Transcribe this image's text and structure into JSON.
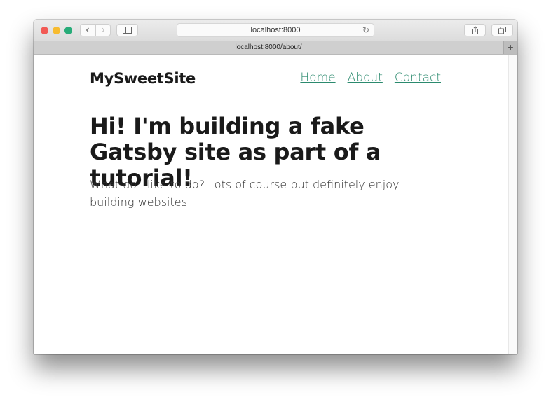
{
  "browser": {
    "address_bar": "localhost:8000",
    "tab_title": "localhost:8000/about/",
    "icons": {
      "back": "chevron-left",
      "forward": "chevron-right",
      "sidebar": "sidebar",
      "reload": "reload",
      "share": "share",
      "tabs": "tabs-overview",
      "new_tab": "plus"
    },
    "glyphs": {
      "back": "‹",
      "forward": "›",
      "reload": "↻",
      "new_tab": "+"
    }
  },
  "site": {
    "title": "MySweetSite",
    "nav": [
      {
        "label": "Home"
      },
      {
        "label": "About"
      },
      {
        "label": "Contact"
      }
    ],
    "link_color": "#2b8a6e"
  },
  "page": {
    "headline": "Hi! I'm building a fake Gatsby site as part of a tutorial!",
    "body": "What do I like to do? Lots of course but definitely enjoy building websites."
  }
}
